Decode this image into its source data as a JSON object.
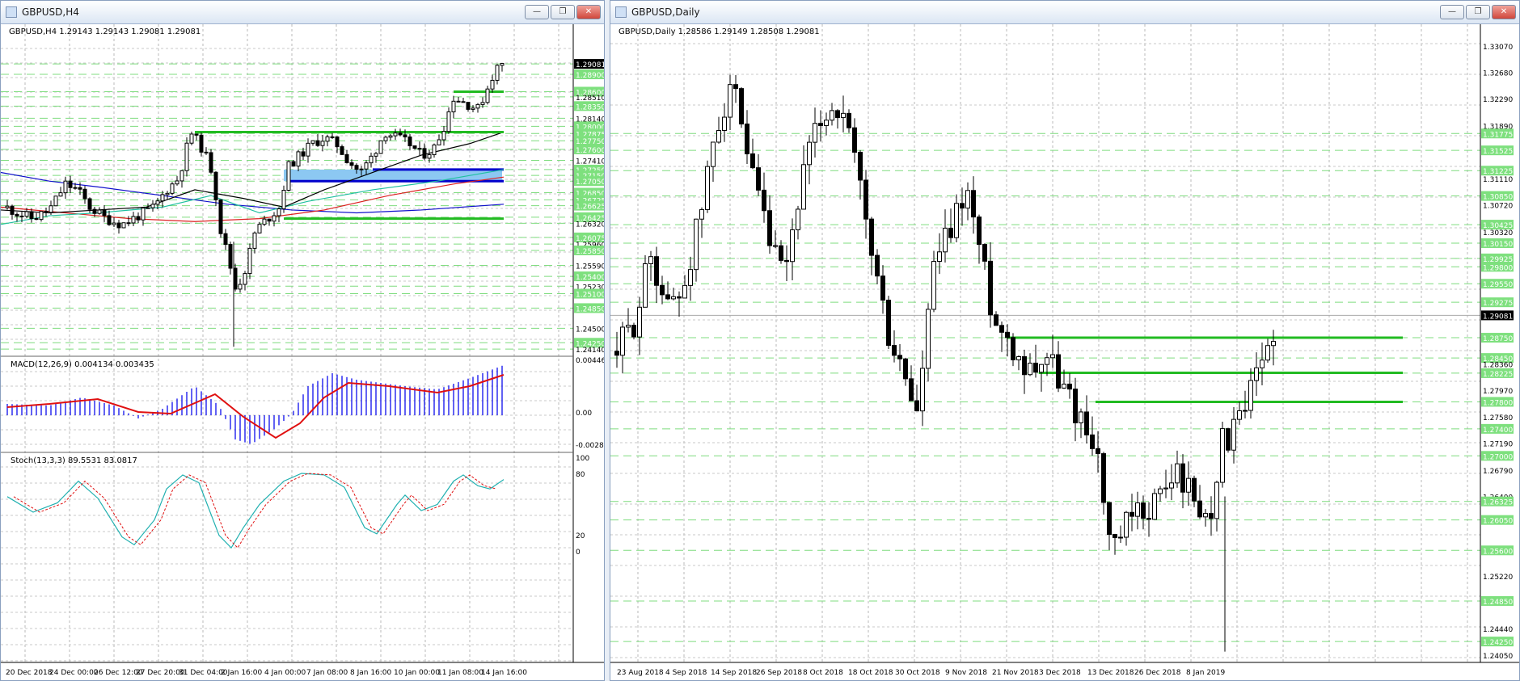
{
  "left_window": {
    "title": "GBPUSD,H4",
    "buttons": {
      "minimize": "—",
      "maximize": "❐",
      "close": "✕"
    },
    "header": "GBPUSD,H4  1.29143 1.29143 1.29081 1.29081",
    "macd_label": "MACD(12,26,9) 0.004134 0.003435",
    "stoch_label": "Stoch(13,3,3) 89.5531 83.0817",
    "price_labels": [
      "1.29081",
      "1.28900",
      "1.28600",
      "1.28510",
      "1.28350",
      "1.28140",
      "1.28000",
      "1.27875",
      "1.27750",
      "1.27600",
      "1.27410",
      "1.27250",
      "1.27150",
      "1.27050",
      "1.26850",
      "1.26725",
      "1.26625",
      "1.26425",
      "1.26320",
      "1.26075",
      "1.25960",
      "1.25850",
      "1.25590",
      "1.25400",
      "1.25230",
      "1.25100",
      "1.24850",
      "1.24500",
      "1.24250",
      "1.24140"
    ],
    "macd_scale": [
      "0.004467",
      "0.00",
      "-0.002871"
    ],
    "stoch_scale": [
      "100",
      "80",
      "20",
      "0"
    ],
    "time_labels": [
      "20 Dec 2018",
      "24 Dec 00:00",
      "26 Dec 12:00",
      "27 Dec 20:00",
      "31 Dec 04:00",
      "2 Jan 16:00",
      "4 Jan 00:00",
      "7 Jan 08:00",
      "8 Jan 16:00",
      "10 Jan 00:00",
      "11 Jan 08:00",
      "14 Jan 16:00"
    ],
    "price_scale": {
      "min": 1.241,
      "max": 1.296
    },
    "levels_solid": [
      1.286,
      1.279,
      1.264
    ],
    "zone": {
      "top": 1.2725,
      "bottom": 1.2705
    },
    "colors": {
      "candle": "#000000",
      "level": "#22bb22",
      "zone": "#8cc8f2",
      "zone_edge": "#0000cc",
      "macd_hist": "#2020ee",
      "macd_signal": "#e01010",
      "stoch_main": "#20b0b0",
      "stoch_signal": "#e01010"
    }
  },
  "right_window": {
    "title": "GBPUSD,Daily",
    "buttons": {
      "minimize": "—",
      "maximize": "❐",
      "close": "✕"
    },
    "header": "GBPUSD,Daily  1.28586 1.29149 1.28508 1.29081",
    "price_labels": [
      "1.33070",
      "1.32680",
      "1.32290",
      "1.31890",
      "1.31775",
      "1.31525",
      "1.31225",
      "1.31110",
      "1.30850",
      "1.30720",
      "1.30425",
      "1.30320",
      "1.30150",
      "1.29925",
      "1.29800",
      "1.29550",
      "1.29275",
      "1.29081",
      "1.28750",
      "1.28450",
      "1.28360",
      "1.28225",
      "1.27970",
      "1.27800",
      "1.27580",
      "1.27400",
      "1.27190",
      "1.27000",
      "1.26790",
      "1.26400",
      "1.26325",
      "1.26050",
      "1.25600",
      "1.25220",
      "1.24850",
      "1.24440",
      "1.24250",
      "1.24050"
    ],
    "time_labels": [
      "23 Aug 2018",
      "4 Sep 2018",
      "14 Sep 2018",
      "26 Sep 2018",
      "8 Oct 2018",
      "18 Oct 2018",
      "30 Oct 2018",
      "9 Nov 2018",
      "21 Nov 2018",
      "3 Dec 2018",
      "13 Dec 2018",
      "26 Dec 2018",
      "8 Jan 2019"
    ],
    "price_scale": {
      "min": 1.24,
      "max": 1.3325
    },
    "levels_solid": [
      1.2875,
      1.2823,
      1.278
    ]
  }
}
